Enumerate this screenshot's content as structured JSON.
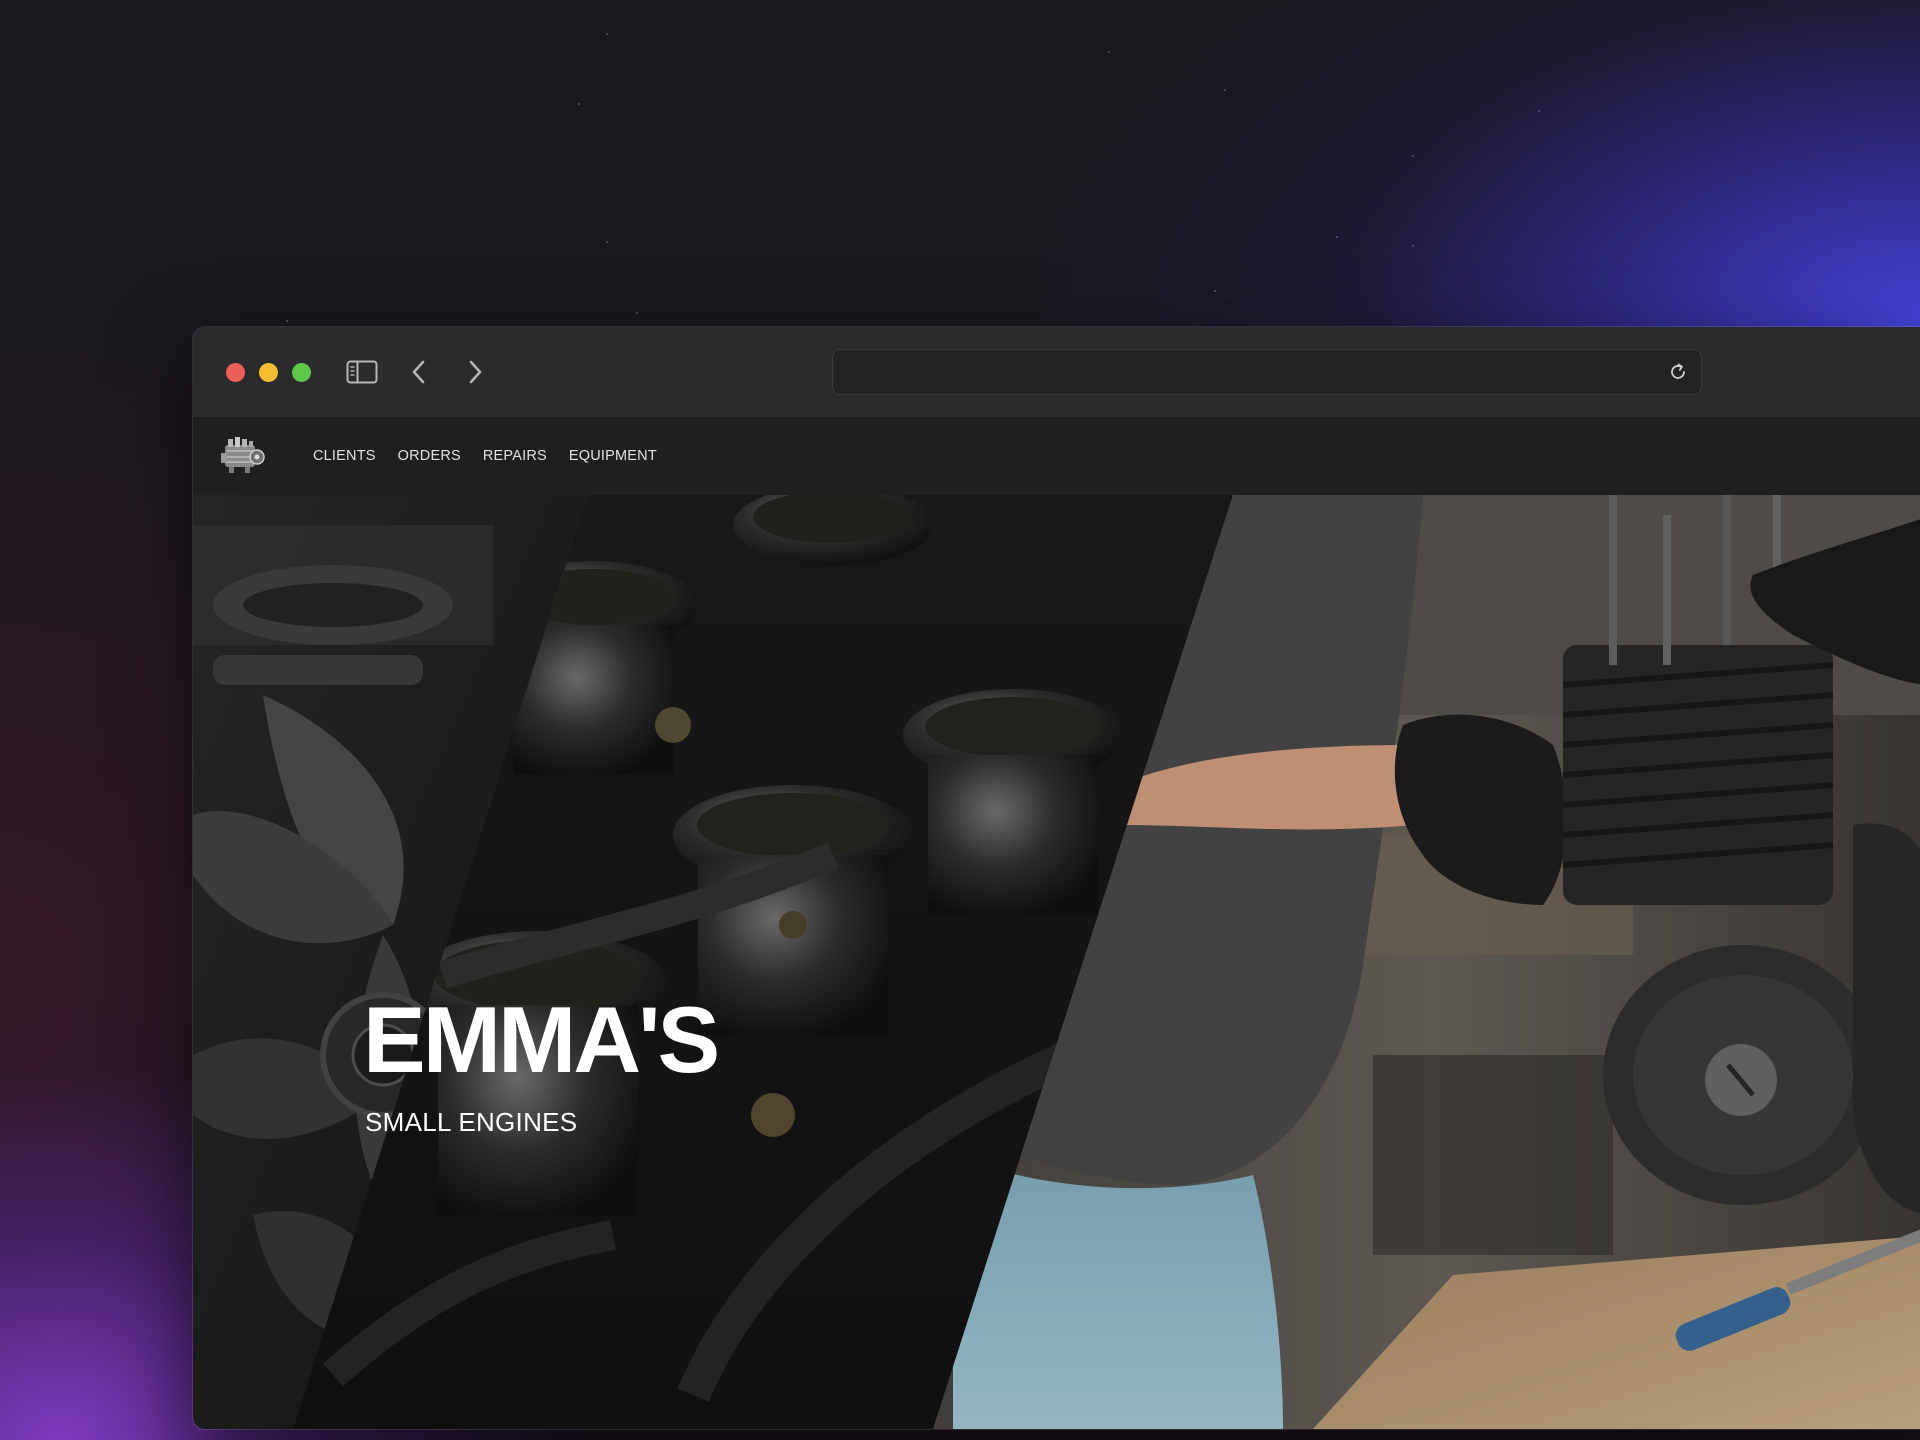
{
  "browser": {
    "address_value": "",
    "icons": {
      "sidebar": "sidebar-icon",
      "back": "chevron-left-icon",
      "forward": "chevron-right-icon",
      "reload": "reload-icon"
    },
    "traffic_lights": {
      "close": "#ec5f57",
      "minimize": "#f5bd2f",
      "zoom": "#5ec648"
    }
  },
  "site": {
    "logo_icon": "engine-logo-icon",
    "nav": [
      {
        "label": "CLIENTS"
      },
      {
        "label": "ORDERS"
      },
      {
        "label": "REPAIRS"
      },
      {
        "label": "EQUIPMENT"
      }
    ],
    "hero": {
      "title": "EMMA'S",
      "subtitle": "SMALL ENGINES",
      "images": [
        "engine-fan-image",
        "carburetors-image",
        "mechanic-engine-image"
      ]
    }
  },
  "colors": {
    "background_accent_blue": "#4646e6",
    "background_accent_purple": "#823cc8",
    "navbar_bg": "#1f1f1f",
    "titlebar_bg": "#2b2a2c"
  }
}
